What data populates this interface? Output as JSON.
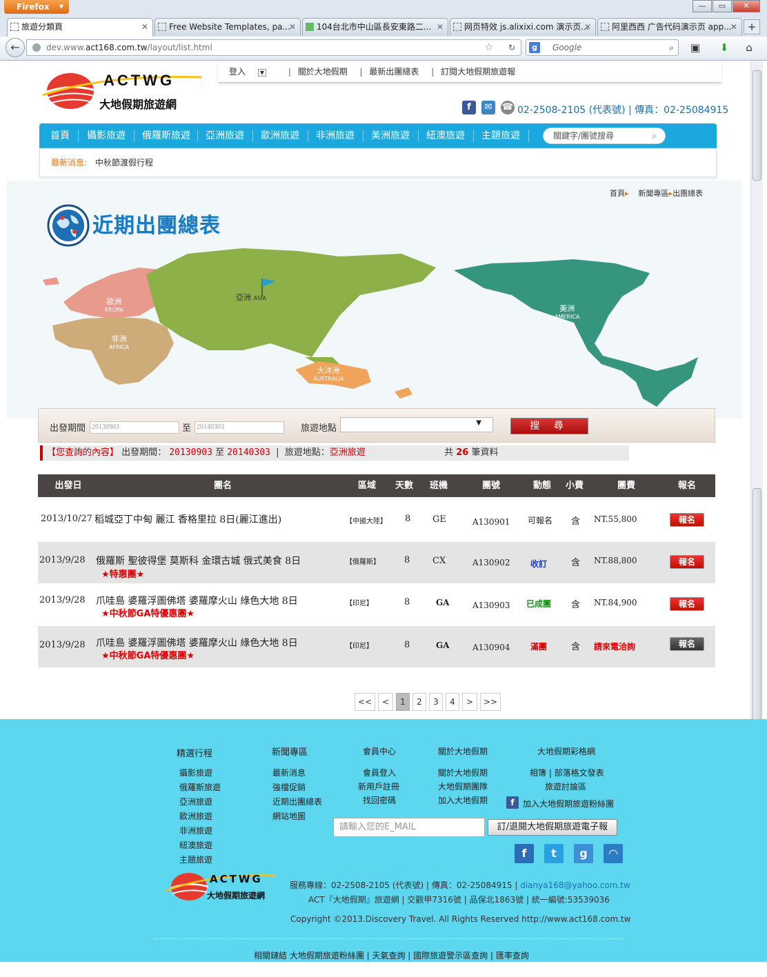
{
  "browser": {
    "app_button": "Firefox",
    "tabs": [
      {
        "label": "旅遊分類頁"
      },
      {
        "label": "Free Website Templates, pa..."
      },
      {
        "label": "104台北市中山區長安東路二..."
      },
      {
        "label": "网页特效 js.alixixi.com 演示页..."
      },
      {
        "label": "阿里西西 广告代码演示页 app..."
      }
    ],
    "url_prefix": "dev.www.",
    "url_domain": "act168.com.tw",
    "url_path": "/layout/list.html",
    "search_placeholder": "Google"
  },
  "site": {
    "logo_text": "ACTWG",
    "logo_subtitle": "大地假期旅遊網",
    "topnav": {
      "login": "登入",
      "about": "關於大地假期",
      "schedule": "最新出團總表",
      "newsletter": "訂閱大地假期旅遊報"
    },
    "contact_text": "02-2508-2105 (代表號) | 傳真：02-25084915",
    "mainnav": [
      {
        "label": "首頁"
      },
      {
        "label": "攝影旅遊"
      },
      {
        "label": "俄羅斯旅遊"
      },
      {
        "label": "亞洲旅遊"
      },
      {
        "label": "歐洲旅遊"
      },
      {
        "label": "非洲旅遊"
      },
      {
        "label": "美洲旅遊"
      },
      {
        "label": "紐澳旅遊"
      },
      {
        "label": "主題旅遊"
      }
    ],
    "keyword_placeholder": "關鍵字/團號搜尋",
    "news_label": "最新消息:",
    "news_text": "中秋節渡假行程"
  },
  "breadcrumb": {
    "home": "首頁",
    "section": "新聞專區",
    "current": "出團總表"
  },
  "page_title": "近期出團總表",
  "map_labels": {
    "europe_cn": "歐洲",
    "europe_en": "EROPA",
    "asia_cn": "亞洲",
    "asia_en": "ASIA",
    "africa_cn": "非洲",
    "africa_en": "AFRICA",
    "australia_cn": "大洋洲",
    "australia_en": "AUSTRALIA",
    "america_cn": "美洲",
    "america_en": "AMERICA"
  },
  "search": {
    "period_label": "出發期間",
    "from": "20130903",
    "to_label": "至",
    "to": "20140303",
    "place_label": "旅遊地點",
    "button": "搜 尋"
  },
  "summary": {
    "prefix": "【您查詢的內容】",
    "period_label": "出發期間：",
    "from": "20130903",
    "to_label": "至",
    "to": "20140303",
    "place_label": "旅遊地點：",
    "place": "亞洲旅遊",
    "count_prefix": "共",
    "count": "26",
    "count_suffix": "筆資料"
  },
  "table": {
    "headers": [
      "出發日",
      "團名",
      "區域",
      "天數",
      "班機",
      "團號",
      "動態",
      "小費",
      "團費",
      "報名"
    ],
    "rows": [
      {
        "date": "2013/10/27",
        "name": "稻城亞丁中甸 麗江 香格里拉 8日(麗江進出)",
        "promo": "",
        "region": "【中國大陸】",
        "days": "8",
        "flight": "GE",
        "code": "A130901",
        "status": "可報名",
        "tip": "含",
        "price": "NT.55,800",
        "register": "報名"
      },
      {
        "date": "2013/9/28",
        "name": "俄羅斯 聖彼得堡 莫斯科 金環古城 俄式美食 8日",
        "promo": "★特惠團★",
        "region": "【俄羅斯】",
        "days": "8",
        "flight": "CX",
        "code": "A130902",
        "status": "收訂",
        "tip": "含",
        "price": "NT.88,800",
        "register": "報名"
      },
      {
        "date": "2013/9/28",
        "name": "爪哇島 婆羅浮圖佛塔 婆羅摩火山 綠色大地 8日",
        "promo": "★中秋節GA特優惠團★",
        "region": "【印尼】",
        "days": "8",
        "flight": "GA",
        "code": "A130903",
        "status": "已成團",
        "tip": "含",
        "price": "NT.84,900",
        "register": "報名"
      },
      {
        "date": "2013/9/28",
        "name": "爪哇島 婆羅浮圖佛塔 婆羅摩火山 綠色大地 8日",
        "promo": "★中秋節GA特優惠團★",
        "region": "【印尼】",
        "days": "8",
        "flight": "GA",
        "code": "A130904",
        "status": "滿團",
        "tip": "含",
        "price": "請來電洽詢",
        "register": "報名"
      }
    ],
    "status_colors": [
      "#222222",
      "#1a3fbf",
      "#1a8f1a",
      "#d00000"
    ]
  },
  "pagination": [
    "<<",
    "<",
    "1",
    "2",
    "3",
    "4",
    ">",
    ">>"
  ],
  "footer": {
    "cols": [
      {
        "title": "精選行程",
        "items": [
          "攝影旅遊",
          "俄羅斯旅遊",
          "亞洲旅遊",
          "歐洲旅遊",
          "非洲旅遊",
          "紐澳旅遊",
          "主題旅遊"
        ]
      },
      {
        "title": "新聞專區",
        "items": [
          "最新消息",
          "強檔促銷",
          "近期出團總表",
          "網站地圖"
        ]
      },
      {
        "title": "會員中心",
        "items": [
          "會員登入",
          "新用戶註冊",
          "找回密碼"
        ]
      },
      {
        "title": "關於大地假期",
        "items": [
          "關於大地假期",
          "大地假期團隊",
          "加入大地假期"
        ]
      },
      {
        "title": "大地假期彩格網",
        "items": [
          "相簿 | 部落格文發表",
          "旅遊討論區"
        ]
      }
    ],
    "fan_link": "加入大地假期旅遊粉絲團",
    "email_placeholder": "請輸入您的E_MAIL",
    "subscribe_button": "訂/退閱大地假期旅遊電子報",
    "info_line1": "服務專線：02-2508-2105 (代表號) | 傳真：02-25084915 | ",
    "info_email": "dianya168@yahoo.com.tw",
    "info_line2": "ACT『大地假期』旅遊網 | 交觀甲7316號 | 品保北1863號 | 統一編號:53539036",
    "copyright": "Copyright ©2013.Discovery Travel. All Rights Reserved http://www.act168.com.tw",
    "links": "相關鏈結 大地假期旅遊粉絲團 | 天氣查詢 | 國際旅遊警示區查詢 | 匯率查詢"
  },
  "colors": {
    "nav_blue": "#1aa8df",
    "footer_blue": "#5dd6ef",
    "red_accent": "#cc0000",
    "table_header": "#4a4543"
  }
}
